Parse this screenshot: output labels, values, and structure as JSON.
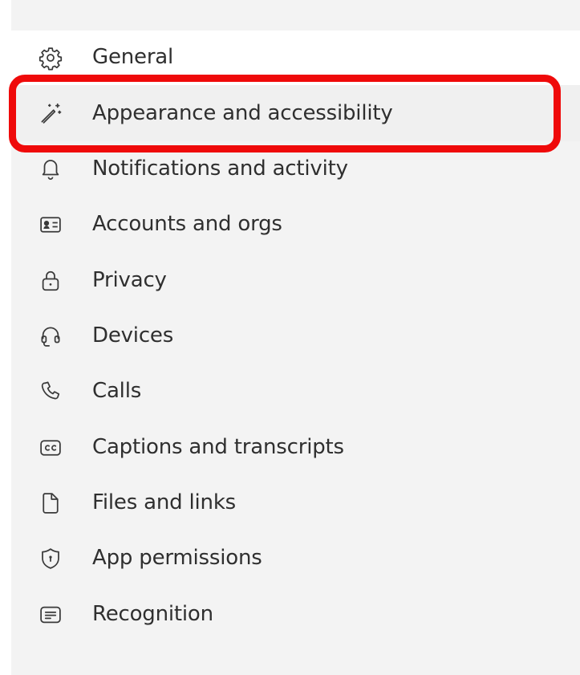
{
  "settings_nav": {
    "items": [
      {
        "label": "General",
        "icon": "gear-icon"
      },
      {
        "label": "Appearance and accessibility",
        "icon": "magic-wand-icon"
      },
      {
        "label": "Notifications and activity",
        "icon": "bell-icon"
      },
      {
        "label": "Accounts and orgs",
        "icon": "contact-card-icon"
      },
      {
        "label": "Privacy",
        "icon": "lock-icon"
      },
      {
        "label": "Devices",
        "icon": "headset-icon"
      },
      {
        "label": "Calls",
        "icon": "phone-icon"
      },
      {
        "label": "Captions and transcripts",
        "icon": "closed-captions-icon"
      },
      {
        "label": "Files and links",
        "icon": "document-icon"
      },
      {
        "label": "App permissions",
        "icon": "shield-icon"
      },
      {
        "label": "Recognition",
        "icon": "recognition-icon"
      }
    ],
    "selected_item": "Appearance and accessibility",
    "hovered_item": "General"
  },
  "annotation": {
    "highlight_color": "#ef0a0a",
    "highlighted_item": "Appearance and accessibility"
  },
  "colors": {
    "panel_background": "#f3f3f3",
    "text": "#2f2f2f",
    "icon_stroke": "#3a3a3a"
  }
}
